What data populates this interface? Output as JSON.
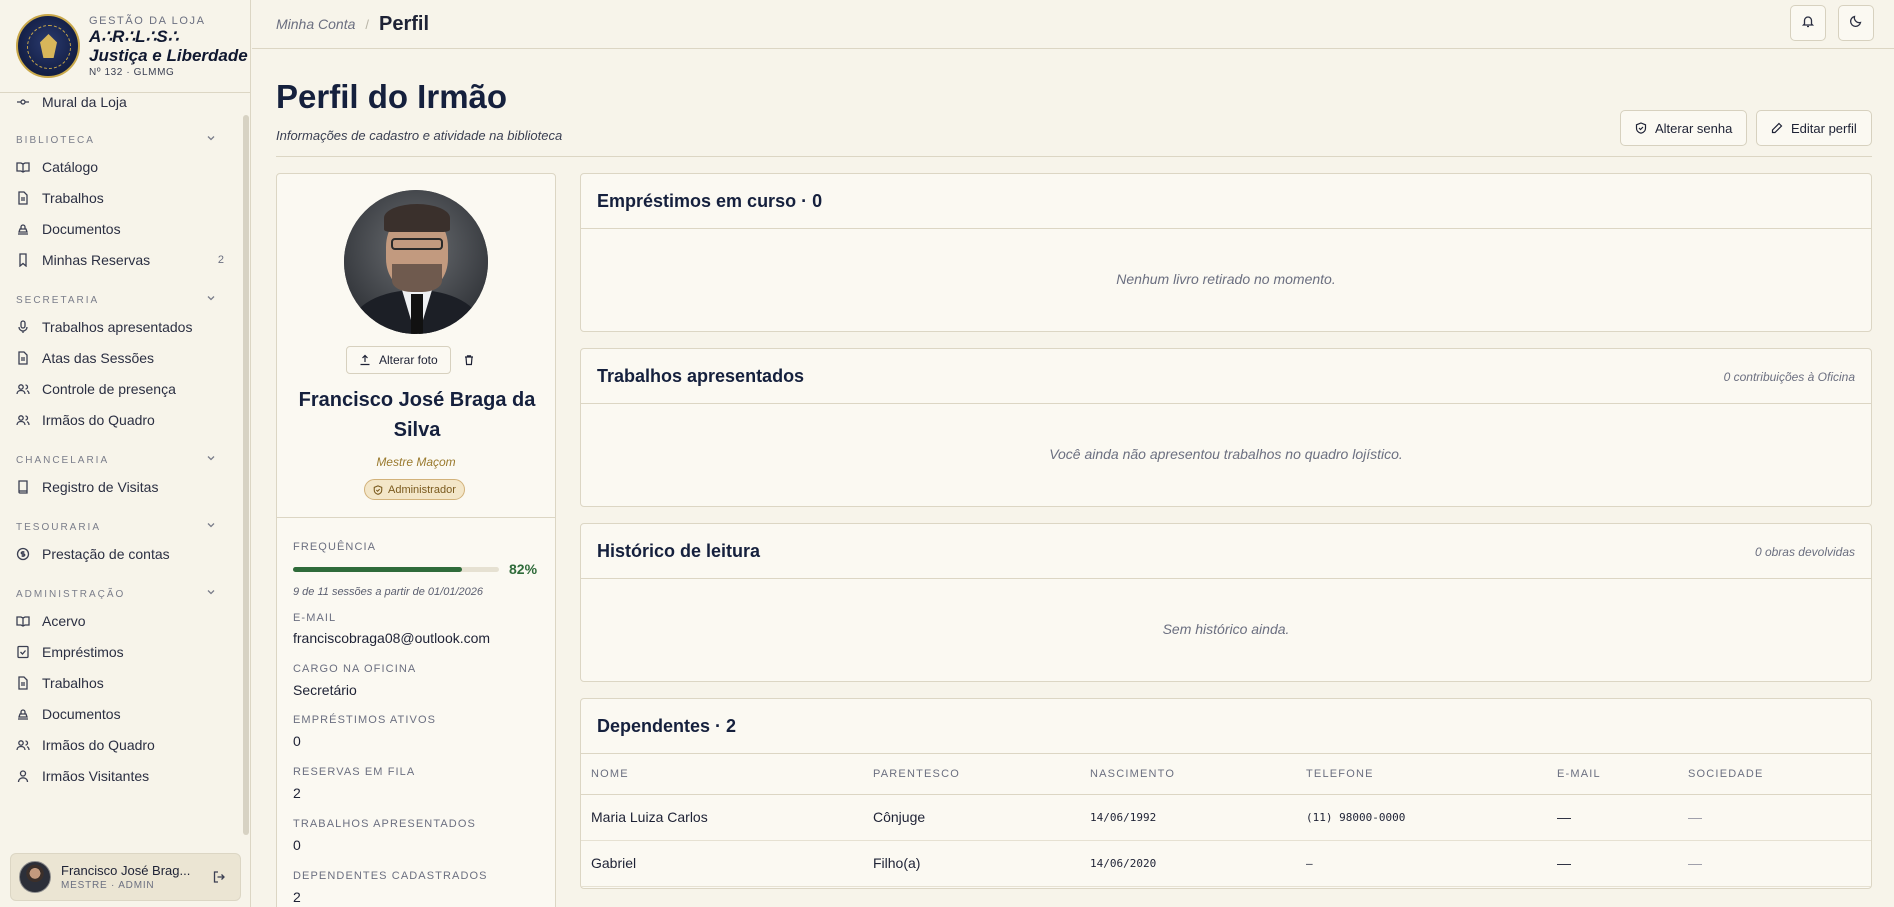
{
  "brand": {
    "subtitle": "GESTÃO DA LOJA",
    "title_line1": "A∴R∴L∴S∴",
    "title_line2": "Justiça e Liberdade",
    "number": "Nº 132 · GLMMG"
  },
  "sidebar": {
    "top_item": {
      "label": "Mural da Loja",
      "icon": "pin-icon"
    },
    "sections": [
      {
        "title": "BIBLIOTECA",
        "items": [
          {
            "label": "Catálogo",
            "icon": "book-open-icon"
          },
          {
            "label": "Trabalhos",
            "icon": "document-icon"
          },
          {
            "label": "Documentos",
            "icon": "stamp-icon"
          },
          {
            "label": "Minhas Reservas",
            "icon": "bookmark-icon",
            "badge": "2"
          }
        ]
      },
      {
        "title": "SECRETARIA",
        "items": [
          {
            "label": "Trabalhos apresentados",
            "icon": "microphone-icon"
          },
          {
            "label": "Atas das Sessões",
            "icon": "document-icon"
          },
          {
            "label": "Controle de presença",
            "icon": "users-icon"
          },
          {
            "label": "Irmãos do Quadro",
            "icon": "users-icon"
          }
        ]
      },
      {
        "title": "CHANCELARIA",
        "items": [
          {
            "label": "Registro de Visitas",
            "icon": "book-icon"
          }
        ]
      },
      {
        "title": "TESOURARIA",
        "items": [
          {
            "label": "Prestação de contas",
            "icon": "coin-icon"
          }
        ]
      },
      {
        "title": "ADMINISTRAÇÃO",
        "items": [
          {
            "label": "Acervo",
            "icon": "book-open-icon"
          },
          {
            "label": "Empréstimos",
            "icon": "document-check-icon"
          },
          {
            "label": "Trabalhos",
            "icon": "document-icon"
          },
          {
            "label": "Documentos",
            "icon": "stamp-icon"
          },
          {
            "label": "Irmãos do Quadro",
            "icon": "users-icon"
          },
          {
            "label": "Irmãos Visitantes",
            "icon": "user-icon"
          }
        ]
      }
    ]
  },
  "user": {
    "name": "Francisco José Brag...",
    "role": "MESTRE · ADMIN"
  },
  "topbar": {
    "crumb_parent": "Minha Conta",
    "separator": "/",
    "crumb_current": "Perfil"
  },
  "page": {
    "title": "Perfil do Irmão",
    "subtitle": "Informações de cadastro e atividade na biblioteca",
    "change_password_label": "Alterar senha",
    "edit_profile_label": "Editar perfil"
  },
  "profile": {
    "change_photo_label": "Alterar foto",
    "name": "Francisco José Braga da Silva",
    "degree": "Mestre Maçom",
    "badge": "Administrador",
    "frequency_label": "FREQUÊNCIA",
    "frequency_percent": 82,
    "frequency_text": "82%",
    "frequency_note": "9 de 11 sessões a partir de 01/01/2026",
    "email_label": "E-MAIL",
    "email": "franciscobraga08@outlook.com",
    "role_label": "CARGO NA OFICINA",
    "role": "Secretário",
    "loans_label": "EMPRÉSTIMOS ATIVOS",
    "loans": "0",
    "reservations_label": "RESERVAS EM FILA",
    "reservations": "2",
    "works_label": "TRABALHOS APRESENTADOS",
    "works": "0",
    "dependents_label": "DEPENDENTES CADASTRADOS",
    "dependents": "2"
  },
  "panels": {
    "loans": {
      "title": "Empréstimos em curso · 0",
      "empty": "Nenhum livro retirado no momento."
    },
    "works": {
      "title": "Trabalhos apresentados",
      "meta": "0 contribuições à Oficina",
      "empty": "Você ainda não apresentou trabalhos no quadro lojístico."
    },
    "history": {
      "title": "Histórico de leitura",
      "meta": "0 obras devolvidas",
      "empty": "Sem histórico ainda."
    },
    "dependents": {
      "title": "Dependentes · 2",
      "columns": [
        "NOME",
        "PARENTESCO",
        "NASCIMENTO",
        "TELEFONE",
        "E-MAIL",
        "SOCIEDADE"
      ],
      "rows": [
        [
          "Maria Luiza Carlos",
          "Cônjuge",
          "14/06/1992",
          "(11) 98000-0000",
          "—",
          "—"
        ],
        [
          "Gabriel",
          "Filho(a)",
          "14/06/2020",
          "–",
          "—",
          "—"
        ]
      ]
    }
  },
  "colors": {
    "background": "#f7f4ea",
    "accent_green": "#2f6b3a",
    "accent_gold": "#9a7a2e",
    "navy": "#15203d"
  }
}
